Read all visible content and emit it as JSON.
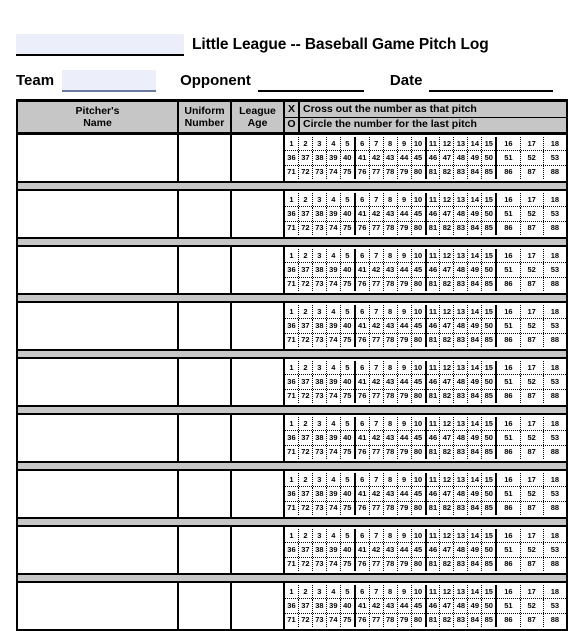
{
  "document": {
    "title": "Little League -- Baseball Game Pitch Log",
    "team_label": "Team",
    "opponent_label": "Opponent",
    "date_label": "Date",
    "team_value": "",
    "opponent_value": "",
    "date_value": "",
    "league_name_value": ""
  },
  "table": {
    "headers": {
      "pitchers_name": "Pitcher's\nName",
      "pitchers_name_line1": "Pitcher's",
      "pitchers_name_line2": "Name",
      "uniform_number_line1": "Uniform",
      "uniform_number_line2": "Number",
      "league_age_line1": "League",
      "league_age_line2": "Age",
      "blank": "",
      "x_letter": "X",
      "o_letter": "O",
      "x_instruction": "Cross out the number as that pitch",
      "o_instruction": "Circle the number for the last pitch"
    },
    "row_count": 9,
    "number_grid": {
      "groups": [
        {
          "rows": [
            [
              1,
              2,
              3,
              4,
              5
            ],
            [
              36,
              37,
              38,
              39,
              40
            ],
            [
              71,
              72,
              73,
              74,
              75
            ]
          ]
        },
        {
          "rows": [
            [
              6,
              7,
              8,
              9,
              10
            ],
            [
              41,
              42,
              43,
              44,
              45
            ],
            [
              76,
              77,
              78,
              79,
              80
            ]
          ]
        },
        {
          "rows": [
            [
              11,
              12,
              13,
              14,
              15
            ],
            [
              46,
              47,
              48,
              49,
              50
            ],
            [
              81,
              82,
              83,
              84,
              85
            ]
          ]
        },
        {
          "rows": [
            [
              16,
              17,
              18
            ],
            [
              51,
              52,
              53
            ],
            [
              86,
              87,
              88
            ]
          ]
        }
      ]
    }
  },
  "colors": {
    "header_fill": "#c6c6c6",
    "field_fill": "#eceefa",
    "border": "#000000",
    "field_underline_blue": "#6b7aa0"
  }
}
